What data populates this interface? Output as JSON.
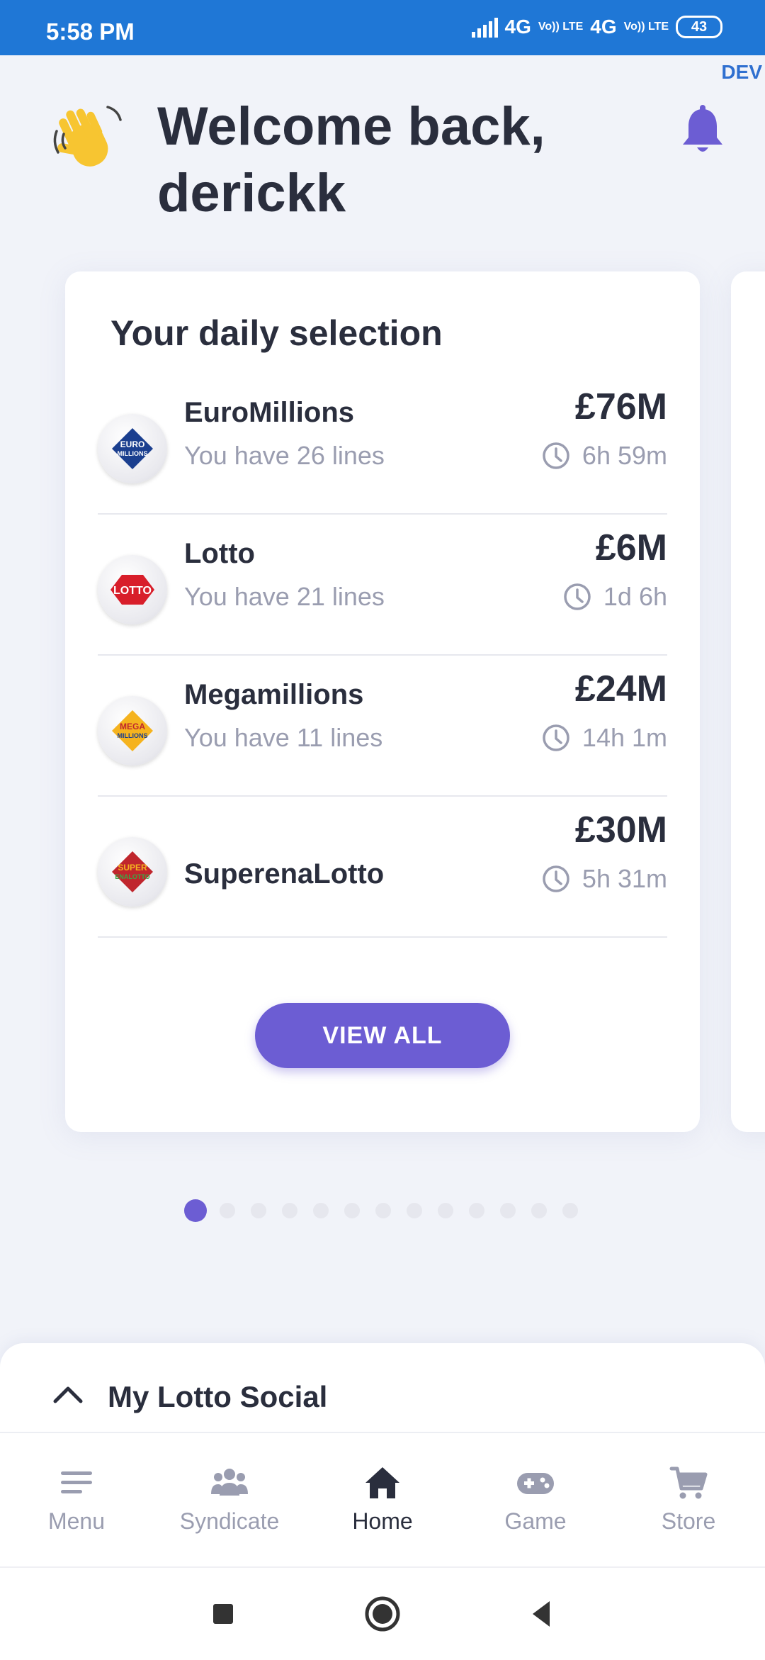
{
  "status_bar": {
    "time": "5:58 PM",
    "network_1": "4G",
    "network_2": "4G",
    "volte": "Vo)) LTE",
    "battery": "43"
  },
  "dev_tag": "DEV",
  "header": {
    "greeting": "Welcome back, derickk",
    "wave_icon": "waving-hand-icon",
    "bell_icon": "bell-icon"
  },
  "colors": {
    "accent": "#6c5dd3",
    "status_bar": "#1f77d6",
    "muted_text": "#9a9db0",
    "primary_text": "#2a2e3d"
  },
  "daily_selection": {
    "title": "Your daily selection",
    "games": [
      {
        "name": "EuroMillions",
        "lines": "You have 26 lines",
        "jackpot": "£76M",
        "countdown": "6h 59m",
        "logo_text": [
          "EURO",
          "MILLIONS"
        ]
      },
      {
        "name": "Lotto",
        "lines": "You have 21 lines",
        "jackpot": "£6M",
        "countdown": "1d 6h",
        "logo_text": [
          "LOTTO"
        ]
      },
      {
        "name": "Megamillions",
        "lines": "You have 11 lines",
        "jackpot": "£24M",
        "countdown": "14h 1m",
        "logo_text": [
          "MEGA",
          "MILLIONS"
        ]
      },
      {
        "name": "SuperenaLotto",
        "lines": "",
        "jackpot": "£30M",
        "countdown": "5h 31m",
        "logo_text": [
          "SUPER",
          "ENALOTTO"
        ]
      }
    ],
    "view_all_label": "VIEW ALL"
  },
  "pager": {
    "total": 13,
    "active_index": 0
  },
  "social": {
    "title": "My Lotto Social"
  },
  "bottom_nav": {
    "items": [
      {
        "label": "Menu",
        "icon": "menu-icon"
      },
      {
        "label": "Syndicate",
        "icon": "group-icon"
      },
      {
        "label": "Home",
        "icon": "home-icon",
        "active": true
      },
      {
        "label": "Game",
        "icon": "gamepad-icon"
      },
      {
        "label": "Store",
        "icon": "cart-icon"
      }
    ]
  }
}
